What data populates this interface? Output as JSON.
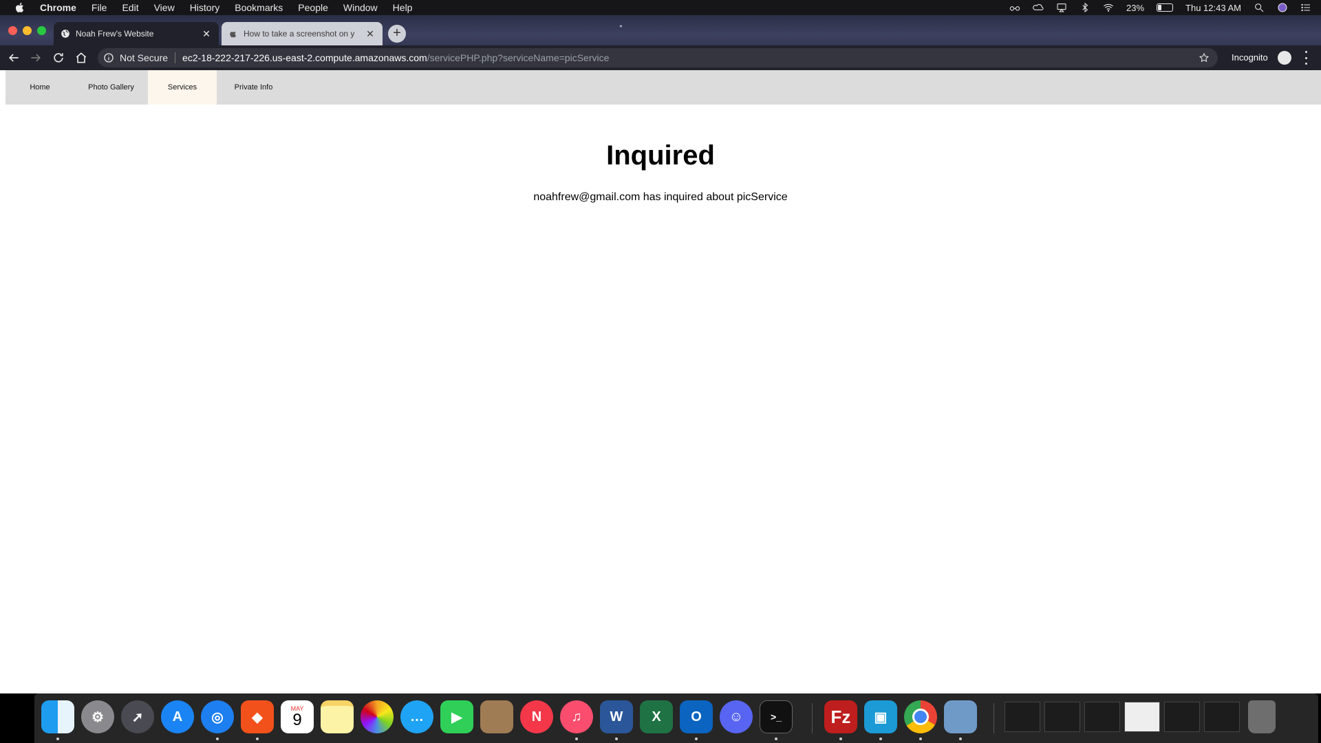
{
  "menubar": {
    "app_name": "Chrome",
    "items": [
      "File",
      "Edit",
      "View",
      "History",
      "Bookmarks",
      "People",
      "Window",
      "Help"
    ],
    "battery_percent": "23%",
    "clock": "Thu 12:43 AM"
  },
  "browser": {
    "tabs": [
      {
        "title": "Noah Frew's Website",
        "active": true
      },
      {
        "title": "How to take a screenshot on y",
        "active": false
      }
    ],
    "omnibox": {
      "security_label": "Not Secure",
      "host": "ec2-18-222-217-226.us-east-2.compute.amazonaws.com",
      "path": "/servicePHP.php?serviceName=picService"
    },
    "profile_label": "Incognito"
  },
  "site": {
    "nav": [
      "Home",
      "Photo Gallery",
      "Services",
      "Private Info"
    ],
    "active_nav": "Services",
    "heading": "Inquired",
    "message": "noahfrew@gmail.com has inquired about picService"
  },
  "dock": {
    "calendar_month": "MAY",
    "calendar_day": "9",
    "icons": [
      "finder-icon",
      "system-preferences-icon",
      "launchpad-icon",
      "app-store-icon",
      "safari-icon",
      "brave-icon",
      "calendar-icon",
      "notes-icon",
      "photos-icon",
      "messages-icon",
      "facetime-icon",
      "contacts-icon",
      "news-icon",
      "music-icon",
      "word-icon",
      "excel-icon",
      "outlook-icon",
      "discord-icon",
      "terminal-icon",
      "filezilla-icon",
      "tableplus-icon",
      "chrome-icon",
      "preview-icon"
    ]
  }
}
